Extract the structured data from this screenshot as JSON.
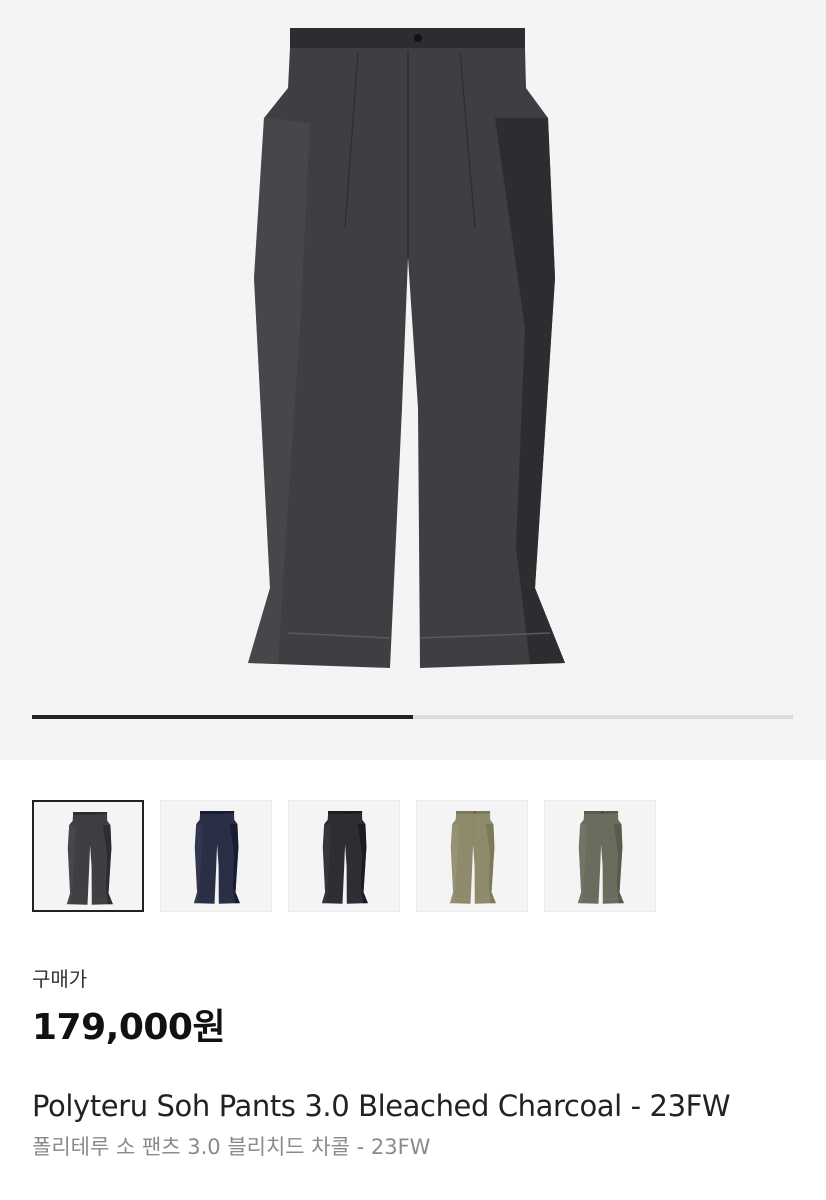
{
  "product": {
    "main_image": {
      "name": "bleached-charcoal-pants",
      "color": "#3f3f43",
      "background": "#f4f4f4"
    },
    "gallery_progress": 0.5,
    "thumbnails": [
      {
        "name": "bleached-charcoal",
        "color": "#3f3f43",
        "selected": true
      },
      {
        "name": "navy",
        "color": "#2a2f45",
        "selected": false
      },
      {
        "name": "charcoal",
        "color": "#2d2e33",
        "selected": false
      },
      {
        "name": "beige",
        "color": "#8e8a6c",
        "selected": false
      },
      {
        "name": "olive",
        "color": "#6a6d5e",
        "selected": false
      }
    ],
    "price_label": "구매가",
    "price": "179,000원",
    "title_en": "Polyteru Soh Pants 3.0 Bleached Charcoal - 23FW",
    "title_ko": "폴리테루 소 팬츠 3.0 블리치드 차콜 - 23FW"
  }
}
